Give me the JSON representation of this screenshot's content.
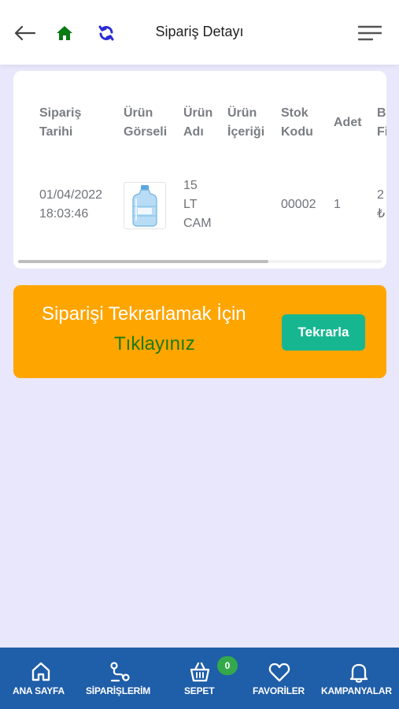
{
  "header": {
    "title": "Sipariş Detayı",
    "icons": {
      "back": "arrow-left-icon",
      "home": "home-icon",
      "refresh": "refresh-icon",
      "menu": "hamburger-menu-icon"
    },
    "colors": {
      "home": "#0a7a12",
      "refresh": "#2b2bd8"
    }
  },
  "table": {
    "headers": {
      "order_date": [
        "Sipariş",
        "Tarihi"
      ],
      "product_image": [
        "Ürün",
        "Görseli"
      ],
      "product_name": [
        "Ürün",
        "Adı"
      ],
      "product_content": [
        "Ürün",
        "İçeriği"
      ],
      "stock_code": [
        "Stok",
        "Kodu"
      ],
      "quantity": "Adet",
      "unit_price": [
        "B",
        "Fi"
      ]
    },
    "rows": [
      {
        "order_date": [
          "01/04/2022",
          "18:03:46"
        ],
        "product_image_icon": "water-jug-icon",
        "product_name": [
          "15",
          "LT",
          "CAM"
        ],
        "product_content": "",
        "stock_code": "00002",
        "quantity": "1",
        "unit_price": [
          "2",
          "₺"
        ]
      }
    ]
  },
  "repeat": {
    "line1": "Siparişi Tekrarlamak İçin",
    "line2": "Tıklayınız",
    "button": "Tekrarla",
    "colors": {
      "box": "#ffa500",
      "line2": "#1d7a13",
      "button": "#16b790"
    }
  },
  "bottom_nav": {
    "items": [
      {
        "label": "ANA SAYFA",
        "icon": "home-outline-icon"
      },
      {
        "label": "SİPARİŞLERİM",
        "icon": "route-icon"
      },
      {
        "label": "SEPET",
        "icon": "basket-icon",
        "badge": "0"
      },
      {
        "label": "FAVORİLER",
        "icon": "heart-icon"
      },
      {
        "label": "KAMPANYALAR",
        "icon": "bell-icon"
      }
    ],
    "colors": {
      "background": "#1f5ea8",
      "badge": "#34a94b"
    }
  }
}
